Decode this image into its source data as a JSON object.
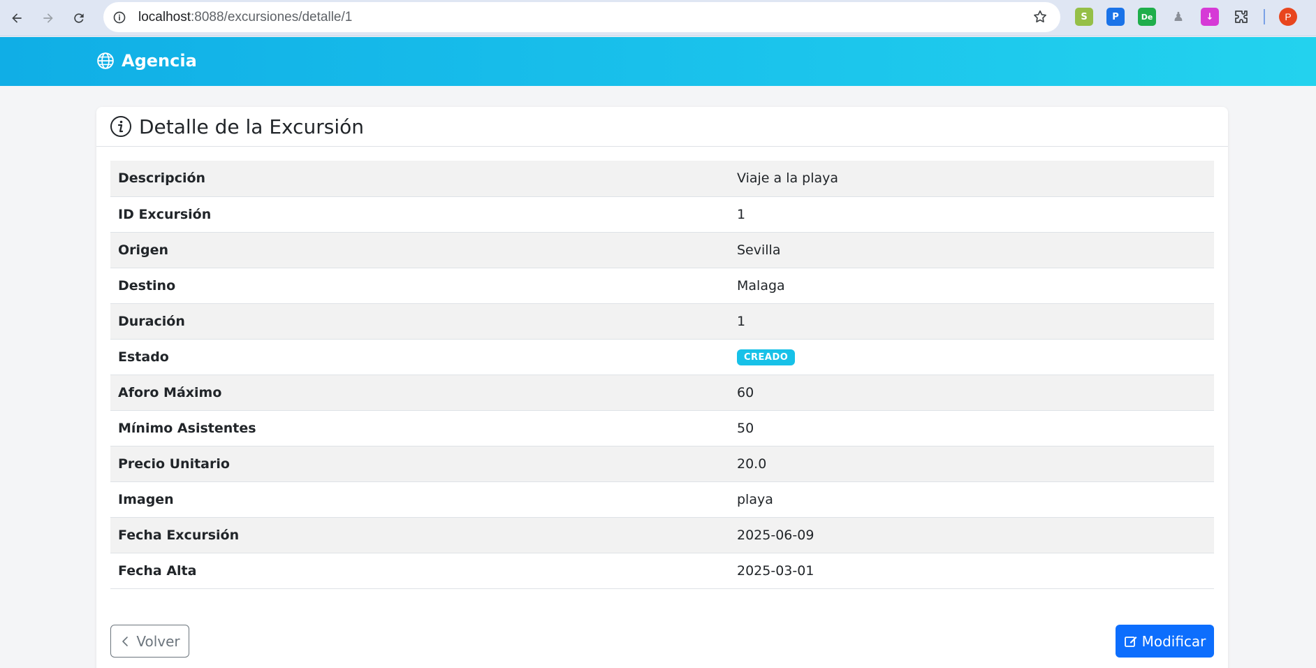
{
  "browser": {
    "url_host": "localhost",
    "url_rest": ":8088/excursiones/detalle/1",
    "profile_initial": "P",
    "extensions": [
      {
        "name": "shopify-extension-icon",
        "glyph": "S",
        "color": "#95bf47"
      },
      {
        "name": "clipboard-extension-icon",
        "glyph": "P",
        "color": "#1a73e8"
      },
      {
        "name": "de-extension-icon",
        "glyph": "De",
        "color": "#1fae4b"
      },
      {
        "name": "figure-extension-icon",
        "glyph": "♟",
        "color": "#8a8f98"
      },
      {
        "name": "download-extension-icon",
        "glyph": "↓",
        "color": "#d63ad6"
      }
    ]
  },
  "navbar": {
    "brand": "Agencia"
  },
  "card": {
    "title": "Detalle de la Excursión",
    "rows": [
      {
        "label": "Descripción",
        "value": "Viaje a la playa"
      },
      {
        "label": "ID Excursión",
        "value": "1"
      },
      {
        "label": "Origen",
        "value": "Sevilla"
      },
      {
        "label": "Destino",
        "value": "Malaga"
      },
      {
        "label": "Duración",
        "value": "1"
      },
      {
        "label": "Estado",
        "value": "CREADO",
        "badge": true
      },
      {
        "label": "Aforo Máximo",
        "value": "60"
      },
      {
        "label": "Mínimo Asistentes",
        "value": "50"
      },
      {
        "label": "Precio Unitario",
        "value": "20.0"
      },
      {
        "label": "Imagen",
        "value": "playa"
      },
      {
        "label": "Fecha Excursión",
        "value": "2025-06-09"
      },
      {
        "label": "Fecha Alta",
        "value": "2025-03-01"
      }
    ],
    "back_label": "Volver",
    "edit_label": "Modificar"
  },
  "colors": {
    "accent": "#17c1e8",
    "primary": "#0d6efd",
    "secondary": "#6c757d"
  }
}
